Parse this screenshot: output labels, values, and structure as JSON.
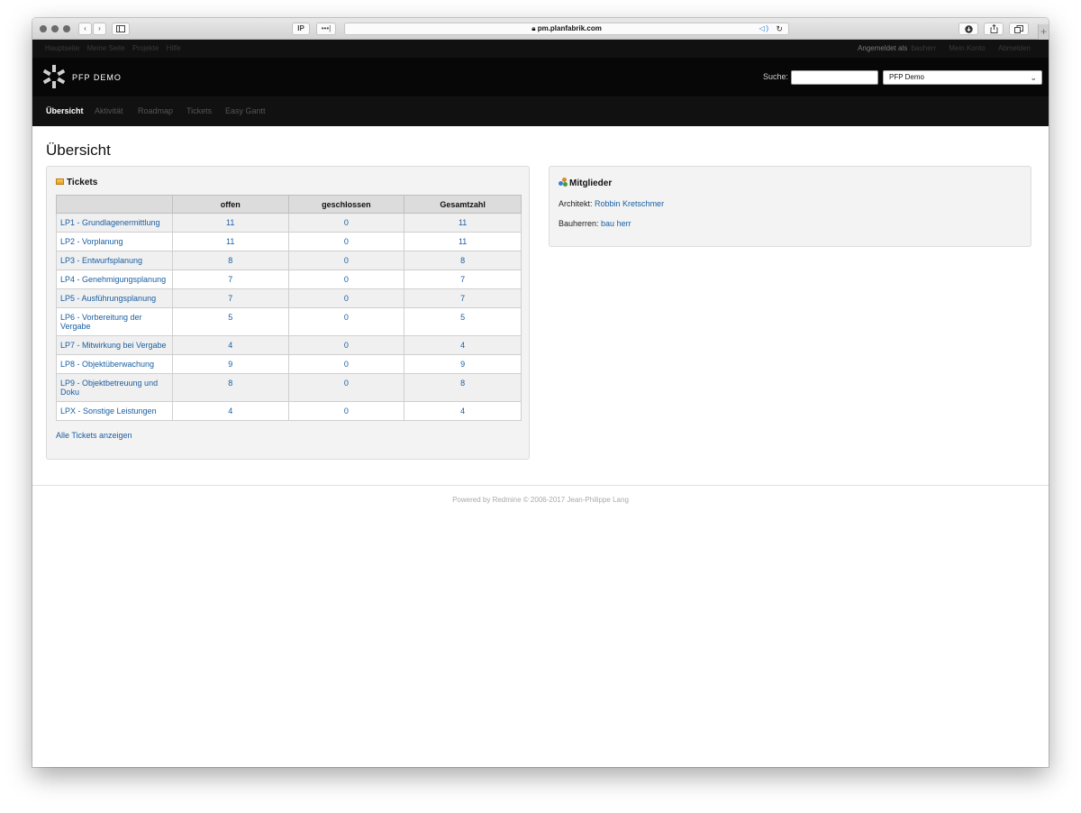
{
  "browser": {
    "address": "pm.planfabrik.com",
    "ip_label": "IP",
    "dots_label": "•••|"
  },
  "topmenu": {
    "items": [
      "Hauptseite",
      "Meine Seite",
      "Projekte",
      "Hilfe"
    ],
    "logged_in_prefix": "Angemeldet als",
    "user": "bauherr",
    "my_account": "Mein Konto",
    "logout": "Abmelden"
  },
  "header": {
    "brand": "PFP DEMO",
    "search_label": "Suche:",
    "project_select": "PFP Demo"
  },
  "mainmenu": {
    "tabs": [
      "Übersicht",
      "Aktivität",
      "Roadmap",
      "Tickets",
      "Easy Gantt"
    ]
  },
  "page": {
    "title": "Übersicht"
  },
  "tickets": {
    "title": "Tickets",
    "columns": [
      "",
      "offen",
      "geschlossen",
      "Gesamtzahl"
    ],
    "rows": [
      {
        "name": "LP1 - Grundlagenermittlung",
        "open": "11",
        "closed": "0",
        "total": "11"
      },
      {
        "name": "LP2 - Vorplanung",
        "open": "11",
        "closed": "0",
        "total": "11"
      },
      {
        "name": "LP3 - Entwurfsplanung",
        "open": "8",
        "closed": "0",
        "total": "8"
      },
      {
        "name": "LP4 - Genehmigungsplanung",
        "open": "7",
        "closed": "0",
        "total": "7"
      },
      {
        "name": "LP5 - Ausführungsplanung",
        "open": "7",
        "closed": "0",
        "total": "7"
      },
      {
        "name": "LP6 - Vorbereitung der Vergabe",
        "open": "5",
        "closed": "0",
        "total": "5"
      },
      {
        "name": "LP7 - Mitwirkung bei Vergabe",
        "open": "4",
        "closed": "0",
        "total": "4"
      },
      {
        "name": "LP8 - Objektüberwachung",
        "open": "9",
        "closed": "0",
        "total": "9"
      },
      {
        "name": "LP9 - Objektbetreuung und Doku",
        "open": "8",
        "closed": "0",
        "total": "8"
      },
      {
        "name": "LPX - Sonstige Leistungen",
        "open": "4",
        "closed": "0",
        "total": "4"
      }
    ],
    "all_link": "Alle Tickets anzeigen"
  },
  "members": {
    "title": "Mitglieder",
    "architect_label": "Architekt:",
    "architect": "Robbin Kretschmer",
    "owner_label": "Bauherren:",
    "owner": "bau herr"
  },
  "footer": {
    "text": "Powered by Redmine © 2006-2017 Jean-Philippe Lang"
  }
}
